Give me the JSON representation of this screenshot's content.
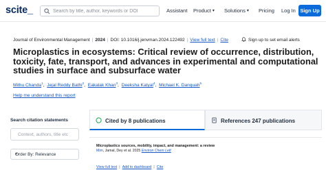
{
  "nav": {
    "logo": "scite_",
    "search_placeholder": "Search by title, author, keywords or DOI",
    "links": [
      "Assistant",
      "Product",
      "Solutions",
      "Pricing",
      "Log In"
    ],
    "signup": "Sign Up",
    "accent_color": "#0b6bdb"
  },
  "paper": {
    "journal": "Journal of Environmental Management",
    "year": "2024",
    "doi": "DOI: 10.1016/j.jenvman.2024.122492",
    "view_full_text": "View full text",
    "cite": "Cite",
    "alert": "Sign up to set email alerts",
    "title": "Microplastics in ecosystems: Critical review of occurrence, distribution, toxicity, fate, transport, and advances in experimental and computational studies in surface and subsurface water",
    "authors": [
      {
        "name": "Mithu Chanda",
        "sup": "1"
      },
      {
        "name": "Jejal Reddy Bathi",
        "sup": "2"
      },
      {
        "name": "Eakalak Khan",
        "sup": "3"
      },
      {
        "name": "Deeksha Katyal",
        "sup": "4"
      },
      {
        "name": "Michael K. Danquah",
        "sup": "5"
      }
    ],
    "help_link": "Help me understand this report"
  },
  "filters": {
    "search_label": "Search citation statements",
    "search_placeholder": "Context, authors, title etc",
    "order": "Order By: Relevance"
  },
  "tabs": {
    "cited": "Cited by 8 publications",
    "references": "References 247 publications"
  },
  "citation": {
    "title": "Microplastics sources, mobility, impact, and management: a review",
    "authors": "Mim",
    "authors_more": ", Jamal",
    "authors_more2": ", Dey",
    "authors_etal": " et al. 2025",
    "journal": "Environ Chem Lett",
    "actions": [
      "View full text",
      "Add to dashboard",
      "Cite"
    ]
  }
}
